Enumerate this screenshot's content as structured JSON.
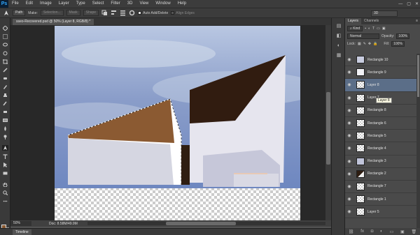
{
  "app": {
    "logo": "Ps"
  },
  "menu": [
    "File",
    "Edit",
    "Image",
    "Layer",
    "Type",
    "Select",
    "Filter",
    "3D",
    "View",
    "Window",
    "Help"
  ],
  "window_controls": [
    "—",
    "▢",
    "✕"
  ],
  "options": {
    "mode": "Path",
    "make_label": "Make:",
    "selection": "Selection...",
    "mask": "Mask",
    "shape": "Shape",
    "auto_add_delete": "Auto Add/Delete",
    "align_edges": "Align Edges",
    "workspace": "3D"
  },
  "document_tab": "sseo-Recovered.psd @ 50% (Layer 8, RGB/8) *",
  "status": {
    "zoom": "50%",
    "doc": "Doc: 8.58M/49.9M"
  },
  "timeline_label": "Timeline",
  "colors": {
    "foreground": "#8b5a32",
    "background": "#ffffff",
    "selected_layer": "#5b6e88"
  },
  "layers_panel": {
    "tabs": [
      "Layers",
      "Channels"
    ],
    "menu_icon": "≡",
    "kind": "Kind",
    "blend": "Normal",
    "opacity_label": "Opacity:",
    "opacity": "100%",
    "lock_label": "Lock:",
    "fill_label": "Fill:",
    "fill": "100%",
    "layers": [
      {
        "name": "Rectangle 10",
        "thumb": "light"
      },
      {
        "name": "Rectangle 9",
        "thumb": "white"
      },
      {
        "name": "Layer 8",
        "thumb": "checker",
        "selected": true
      },
      {
        "name": "Layer 7",
        "thumb": "checker"
      },
      {
        "name": "Rectangle 8",
        "thumb": "checker"
      },
      {
        "name": "Rectangle 6",
        "thumb": "checker"
      },
      {
        "name": "Rectangle 5",
        "thumb": "checker"
      },
      {
        "name": "Rectangle 4",
        "thumb": "checker"
      },
      {
        "name": "Rectangle 3",
        "thumb": "light"
      },
      {
        "name": "Rectangle 2",
        "thumb": "dark"
      },
      {
        "name": "Rectangle 7",
        "thumb": "checker"
      },
      {
        "name": "Rectangle 1",
        "thumb": "checker"
      },
      {
        "name": "Layer 5",
        "thumb": "checker"
      }
    ],
    "tooltip": "Layer 8"
  }
}
